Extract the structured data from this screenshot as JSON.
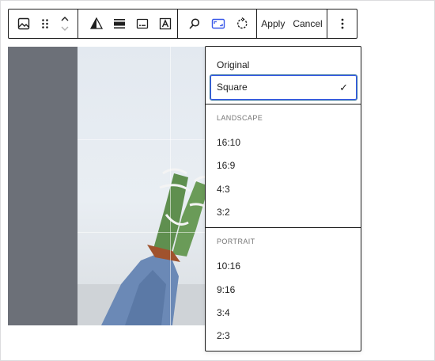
{
  "toolbar": {
    "block_type_icon": "image-icon",
    "drag_icon": "drag-handle-icon",
    "move_icon": "move-up-down-icon",
    "tools": [
      "contrast-icon",
      "align-icon",
      "caption-icon",
      "alt-text-icon"
    ],
    "crop_tools": [
      "zoom-icon",
      "aspect-ratio-icon",
      "rotate-icon"
    ],
    "apply_label": "Apply",
    "cancel_label": "Cancel",
    "more_icon": "more-vertical-icon"
  },
  "aspect_menu": {
    "original_label": "Original",
    "selected_label": "Square",
    "selected_check": "✓",
    "landscape_heading": "LANDSCAPE",
    "landscape_items": [
      "16:10",
      "16:9",
      "4:3",
      "3:2"
    ],
    "portrait_heading": "PORTRAIT",
    "portrait_items": [
      "10:16",
      "9:16",
      "3:4",
      "2:3"
    ]
  },
  "colors": {
    "accent": "#3858e9",
    "border": "#1e1e1e",
    "overlay": "#6c7078"
  }
}
